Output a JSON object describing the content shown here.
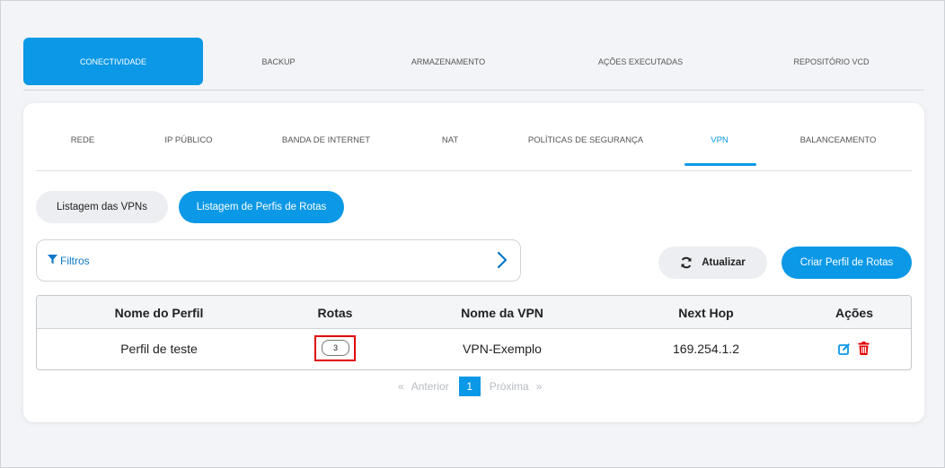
{
  "top_tabs": [
    {
      "label": "CONECTIVIDADE",
      "active": true
    },
    {
      "label": "BACKUP",
      "active": false
    },
    {
      "label": "ARMAZENAMENTO",
      "active": false
    },
    {
      "label": "AÇÕES EXECUTADAS",
      "active": false
    },
    {
      "label": "REPOSITÓRIO VCD",
      "active": false
    }
  ],
  "sub_tabs": [
    {
      "label": "REDE",
      "active": false
    },
    {
      "label": "IP PÚBLICO",
      "active": false
    },
    {
      "label": "BANDA DE INTERNET",
      "active": false
    },
    {
      "label": "NAT",
      "active": false
    },
    {
      "label": "POLÍTICAS DE SEGURANÇA",
      "active": false
    },
    {
      "label": "VPN",
      "active": true
    },
    {
      "label": "BALANCEAMENTO",
      "active": false
    }
  ],
  "list_buttons": {
    "vpns": "Listagem das VPNs",
    "route_profiles": "Listagem de Perfis de Rotas"
  },
  "filters": {
    "label": "Filtros"
  },
  "actions": {
    "refresh": "Atualizar",
    "create": "Criar Perfil de Rotas"
  },
  "table": {
    "headers": [
      "Nome do Perfil",
      "Rotas",
      "Nome da VPN",
      "Next Hop",
      "Ações"
    ],
    "rows": [
      {
        "profile": "Perfil de teste",
        "routes": "3",
        "vpn": "VPN-Exemplo",
        "next_hop": "169.254.1.2"
      }
    ]
  },
  "pagination": {
    "prev_symbol": "«",
    "prev": "Anterior",
    "current": "1",
    "next": "Próxima",
    "next_symbol": "»"
  },
  "colors": {
    "accent": "#0b98e6",
    "delete": "#e00000",
    "highlight": "#e00000"
  },
  "icons": [
    "filter-icon",
    "chevron-right-icon",
    "refresh-icon",
    "edit-icon",
    "trash-icon"
  ]
}
